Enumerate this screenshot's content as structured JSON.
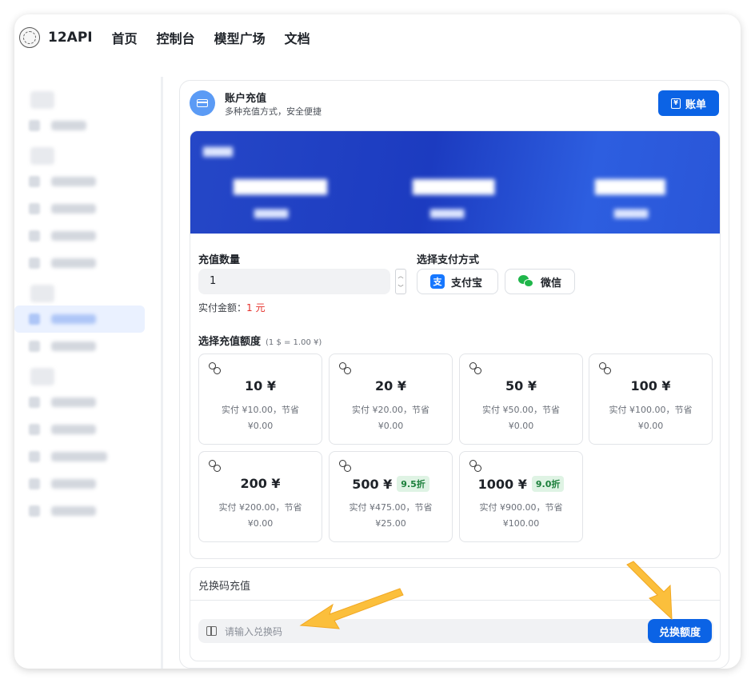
{
  "topbar": {
    "brand": "12API",
    "nav": [
      "首页",
      "控制台",
      "模型广场",
      "文档"
    ]
  },
  "header": {
    "title": "账户充值",
    "subtitle": "多种充值方式，安全便捷",
    "bill_button": "账单"
  },
  "recharge": {
    "quantity_label": "充值数量",
    "quantity_value": "1",
    "actual_label": "实付金额：",
    "actual_value": "1 元",
    "payment_label": "选择支付方式",
    "payment_methods": [
      "支付宝",
      "微信"
    ],
    "alipay_glyph": "支",
    "rate_title": "选择充值额度",
    "rate_note": "(1 $ = 1.00 ¥)"
  },
  "tiles": [
    {
      "amount": "10 ¥",
      "discount": "",
      "detail_line1": "实付 ¥10.00，节省",
      "detail_line2": "¥0.00"
    },
    {
      "amount": "20 ¥",
      "discount": "",
      "detail_line1": "实付 ¥20.00，节省",
      "detail_line2": "¥0.00"
    },
    {
      "amount": "50 ¥",
      "discount": "",
      "detail_line1": "实付 ¥50.00，节省",
      "detail_line2": "¥0.00"
    },
    {
      "amount": "100 ¥",
      "discount": "",
      "detail_line1": "实付 ¥100.00，节省",
      "detail_line2": "¥0.00"
    },
    {
      "amount": "200 ¥",
      "discount": "",
      "detail_line1": "实付 ¥200.00，节省",
      "detail_line2": "¥0.00"
    },
    {
      "amount": "500 ¥",
      "discount": "9.5折",
      "detail_line1": "实付 ¥475.00，节省",
      "detail_line2": "¥25.00"
    },
    {
      "amount": "1000 ¥",
      "discount": "9.0折",
      "detail_line1": "实付 ¥900.00，节省",
      "detail_line2": "¥100.00"
    }
  ],
  "redeem": {
    "title": "兑换码充值",
    "placeholder": "请输入兑换码",
    "button": "兑换额度"
  },
  "colors": {
    "primary": "#0b63e5",
    "banner": "#2547c7",
    "arrow": "#fbbf3c",
    "price_red": "#e5302a",
    "discount_green": "#1b7f3a"
  }
}
